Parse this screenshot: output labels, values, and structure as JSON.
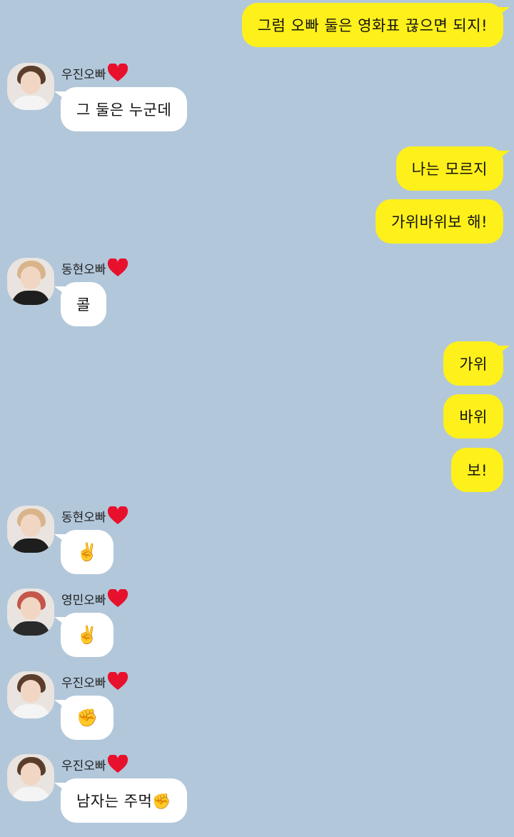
{
  "chat": {
    "background_color": "#b2c7da",
    "my_bubble_color": "#fef01b",
    "other_bubble_color": "#ffffff",
    "heart_icon": "red-heart-icon",
    "messages": [
      {
        "side": "me",
        "text": "그럼 오빠 둘은 영화표 끊으면 되지!"
      },
      {
        "side": "other",
        "sender": "우진오빠",
        "text": "그 둘은 누군데"
      },
      {
        "side": "me",
        "text": "나는 모르지"
      },
      {
        "side": "me",
        "text": "가위바위보 해!"
      },
      {
        "side": "other",
        "sender": "동현오빠",
        "text": "콜"
      },
      {
        "side": "me",
        "text": "가위"
      },
      {
        "side": "me",
        "text": "바위"
      },
      {
        "side": "me",
        "text": "보!"
      },
      {
        "side": "other",
        "sender": "동현오빠",
        "text": "✌️"
      },
      {
        "side": "other",
        "sender": "영민오빠",
        "text": "✌️"
      },
      {
        "side": "other",
        "sender": "우진오빠",
        "text": "✊"
      },
      {
        "side": "other",
        "sender": "우진오빠",
        "text": "남자는 주먹✊"
      }
    ]
  }
}
